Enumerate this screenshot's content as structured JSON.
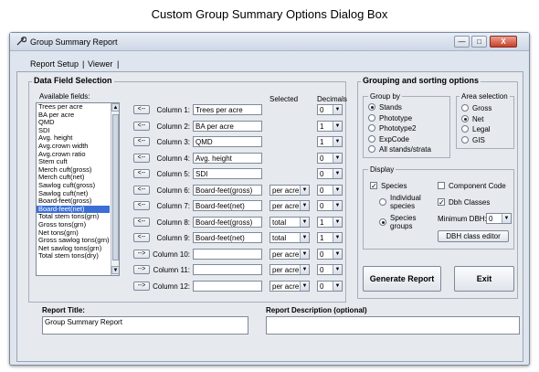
{
  "caption": "Custom Group Summary Options Dialog Box",
  "window": {
    "title": "Group Summary Report",
    "controls": {
      "minimize": "—",
      "maximize": "□",
      "close": "X"
    }
  },
  "tabs": [
    {
      "label": "Report Setup"
    },
    {
      "label": "Viewer"
    }
  ],
  "data_field_selection": {
    "title": "Data Field Selection",
    "available_label": "Available fields:",
    "fields": [
      "Trees per acre",
      "BA per acre",
      "QMD",
      "SDI",
      "Avg. height",
      "Avg.crown width",
      "Avg.crown ratio",
      "Stem cuft",
      "Merch cuft(gross)",
      "Merch cuft(net)",
      "Sawlog cuft(gross)",
      "Sawlog cuft(net)",
      "Board-feet(gross)",
      "Board-feet(net)",
      "Total stem tons(grn)",
      "Gross tons(grn)",
      "Net tons(grn)",
      "Gross sawlog tons(grn)",
      "Net sawlog tons(grn)",
      "Total stem tons(dry)"
    ],
    "selected_index": 13,
    "header_selected": "Selected",
    "header_decimals": "Decimals",
    "columns": [
      {
        "arrow": "<--",
        "label": "Column 1:",
        "value": "Trees per acre",
        "per": "",
        "decimals": "0"
      },
      {
        "arrow": "<--",
        "label": "Column 2:",
        "value": "BA per acre",
        "per": "",
        "decimals": "1"
      },
      {
        "arrow": "<--",
        "label": "Column 3:",
        "value": "QMD",
        "per": "",
        "decimals": "1"
      },
      {
        "arrow": "<--",
        "label": "Column 4:",
        "value": "Avg. height",
        "per": "",
        "decimals": "0"
      },
      {
        "arrow": "<--",
        "label": "Column 5:",
        "value": "SDI",
        "per": "",
        "decimals": "0"
      },
      {
        "arrow": "<--",
        "label": "Column 6:",
        "value": "Board-feet(gross)",
        "per": "per acre",
        "decimals": "0"
      },
      {
        "arrow": "<--",
        "label": "Column 7:",
        "value": "Board-feet(net)",
        "per": "per acre",
        "decimals": "0"
      },
      {
        "arrow": "<--",
        "label": "Column 8:",
        "value": "Board-feet(gross)",
        "per": "total",
        "decimals": "1"
      },
      {
        "arrow": "<--",
        "label": "Column 9:",
        "value": "Board-feet(net)",
        "per": "total",
        "decimals": "1"
      },
      {
        "arrow": "-->",
        "label": "Column 10:",
        "value": "",
        "per": "per acre",
        "decimals": "0"
      },
      {
        "arrow": "-->",
        "label": "Column 11:",
        "value": "",
        "per": "per acre",
        "decimals": "0"
      },
      {
        "arrow": "-->",
        "label": "Column 12:",
        "value": "",
        "per": "per acre",
        "decimals": "0"
      }
    ]
  },
  "grouping": {
    "title": "Grouping and sorting options",
    "group_by_title": "Group by",
    "group_by": [
      {
        "label": "Stands",
        "on": true
      },
      {
        "label": "Phototype",
        "on": false
      },
      {
        "label": "Phototype2",
        "on": false
      },
      {
        "label": "ExpCode",
        "on": false
      },
      {
        "label": "All stands/strata",
        "on": false
      }
    ],
    "area_title": "Area selection",
    "area": [
      {
        "label": "Gross",
        "on": false
      },
      {
        "label": "Net",
        "on": true
      },
      {
        "label": "Legal",
        "on": false
      },
      {
        "label": "GIS",
        "on": false
      }
    ],
    "display_title": "Display",
    "species_label": "Species",
    "component_label": "Component Code",
    "individual_label_1": "Individual",
    "individual_label_2": "species",
    "species_groups_label_1": "Species",
    "species_groups_label_2": "groups",
    "dbh_classes_label": "Dbh Classes",
    "min_dbh_label": "Minimum DBH:",
    "min_dbh_value": "0",
    "dbh_editor_label": "DBH class editor",
    "check_mark": "✓"
  },
  "actions": {
    "generate": "Generate Report",
    "exit": "Exit"
  },
  "report_title": {
    "label": "Report Title:",
    "value": "Group Summary Report"
  },
  "report_description": {
    "label": "Report Description (optional)",
    "value": ""
  }
}
